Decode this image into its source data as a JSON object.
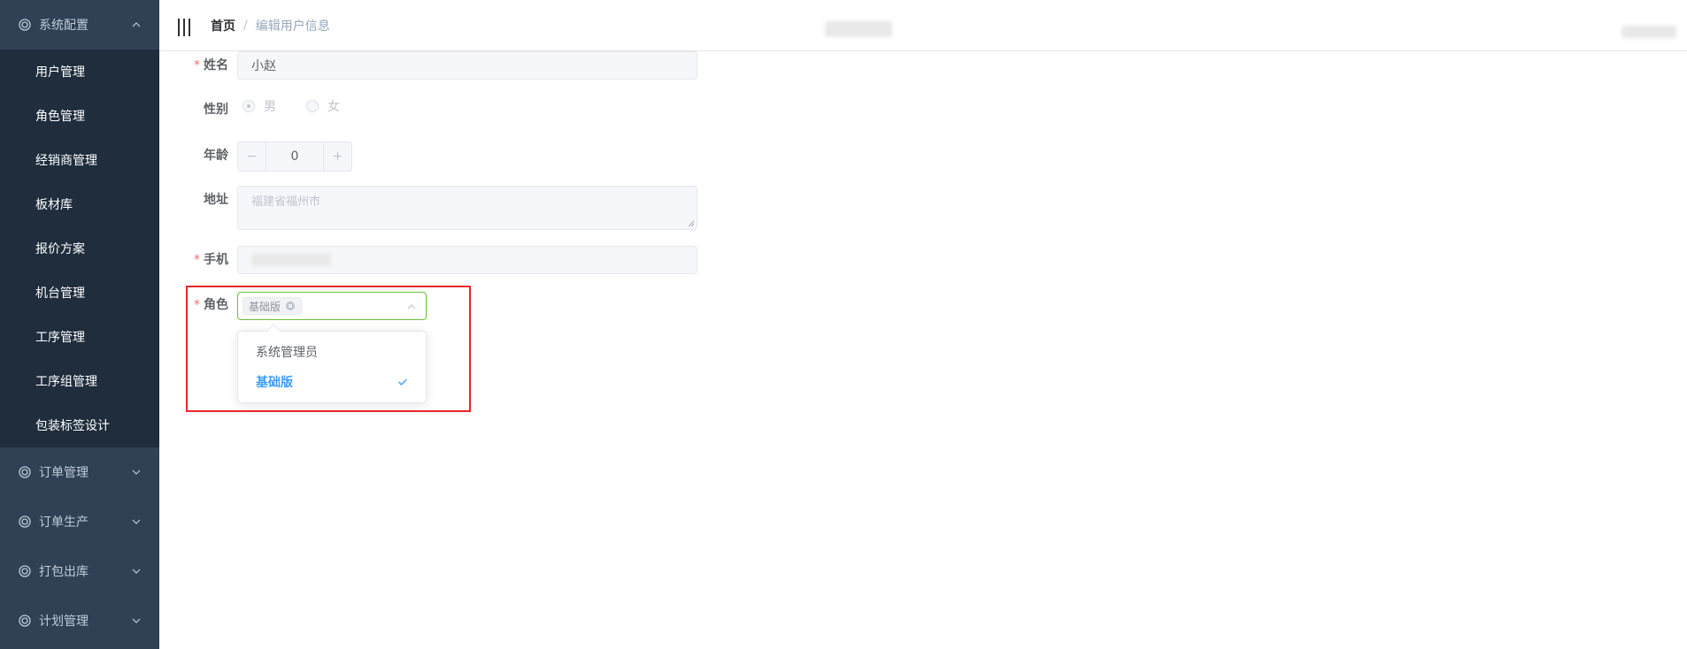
{
  "sidebar": {
    "groups": [
      {
        "label": "系统配置",
        "icon": "gear-icon",
        "expanded": true
      },
      {
        "label": "订单管理",
        "icon": "gear-icon",
        "expanded": false
      },
      {
        "label": "订单生产",
        "icon": "gear-icon",
        "expanded": false
      },
      {
        "label": "打包出库",
        "icon": "gear-icon",
        "expanded": false
      },
      {
        "label": "计划管理",
        "icon": "gear-icon",
        "expanded": false
      }
    ],
    "submenu": [
      {
        "label": "用户管理"
      },
      {
        "label": "角色管理"
      },
      {
        "label": "经销商管理"
      },
      {
        "label": "板材库"
      },
      {
        "label": "报价方案"
      },
      {
        "label": "机台管理"
      },
      {
        "label": "工序管理"
      },
      {
        "label": "工序组管理"
      },
      {
        "label": "包装标签设计"
      }
    ],
    "colors": {
      "background": "#304156",
      "submenu_background": "#1f2d3d",
      "text": "#bfcbd9"
    }
  },
  "header": {
    "breadcrumb": {
      "home": "首页",
      "separator": "/",
      "current": "编辑用户信息"
    }
  },
  "form": {
    "name": {
      "label": "姓名",
      "required": true,
      "value": "小赵"
    },
    "gender": {
      "label": "性别",
      "options": [
        {
          "label": "男",
          "checked": true
        },
        {
          "label": "女",
          "checked": false
        }
      ]
    },
    "age": {
      "label": "年龄",
      "value": "0",
      "minus": "−",
      "plus": "+"
    },
    "address": {
      "label": "地址",
      "placeholder": "福建省福州市"
    },
    "phone": {
      "label": "手机",
      "required": true
    },
    "role": {
      "label": "角色",
      "required": true,
      "selected_tags": [
        "基础版"
      ],
      "options": [
        {
          "label": "系统管理员",
          "selected": false
        },
        {
          "label": "基础版",
          "selected": true
        }
      ]
    },
    "required_mark": "*"
  },
  "colors": {
    "accent": "#409eff",
    "required": "#f56c6c",
    "focus_border": "#67c23a",
    "highlight": "#e8262a"
  }
}
